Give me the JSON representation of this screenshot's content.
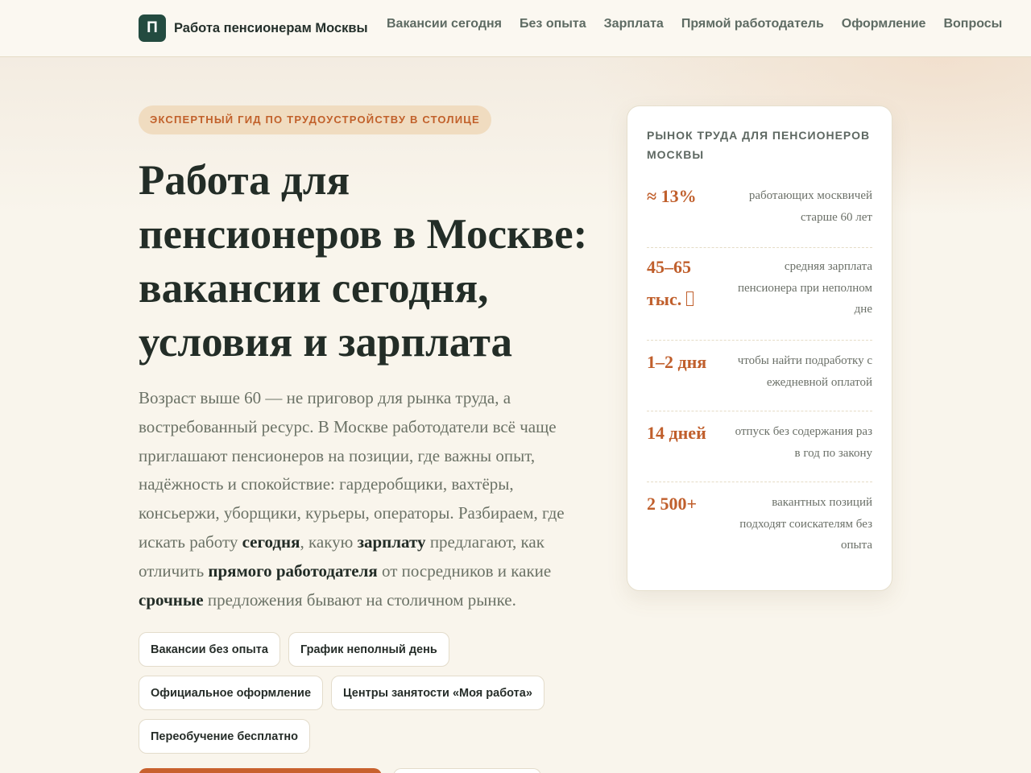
{
  "header": {
    "logo_letter": "П",
    "brand_name": "Работа пенсионерам Москвы",
    "nav": [
      "Вакансии сегодня",
      "Без опыта",
      "Зарплата",
      "Прямой работодатель",
      "Оформление",
      "Вопросы"
    ]
  },
  "hero": {
    "eyebrow": "ЭКСПЕРТНЫЙ ГИД ПО ТРУДОУСТРОЙСТВУ В СТОЛИЦЕ",
    "title": "Работа для пенсионеров в Москве: вакансии сегодня, условия и зарплата",
    "lead": {
      "p1": "Возраст выше 60 — не приговор для рынка труда, а востребованный ресурс. В Москве работодатели всё чаще приглашают пенсионеров на позиции, где важны опыт, надёжность и спокойствие: гардеробщики, вахтёры, консьержи, уборщики, курьеры, операторы. Разбираем, где искать работу ",
      "b1": "сегодня",
      "p2": ", какую ",
      "b2": "зарплату",
      "p3": " предлагают, как отличить ",
      "b3": "прямого работодателя",
      "p4": " от посредников и какие ",
      "b4": "срочные",
      "p5": " предложения бывают на столичном рынке."
    },
    "chips": [
      "Вакансии без опыта",
      "График неполный день",
      "Официальное оформление",
      "Центры занятости «Моя работа»",
      "Переобучение бесплатно"
    ]
  },
  "stats_card": {
    "title": "РЫНОК ТРУДА ДЛЯ ПЕНСИОНЕРОВ МОСКВЫ",
    "items": [
      {
        "value": "≈ 13%",
        "desc": "работающих москвичей старше 60 лет"
      },
      {
        "value": "45–65 тыс.",
        "desc": "средняя зарплата пенсионера при неполном дне"
      },
      {
        "value": "1–2 дня",
        "desc": "чтобы найти подработку с ежедневной оплатой"
      },
      {
        "value": "14 дней",
        "desc": "отпуск без содержания раз в год по закону"
      },
      {
        "value": "2 500+",
        "desc": "вакантных позиций подходят соискателям без опыта"
      }
    ]
  },
  "colors": {
    "accent": "#c05f2c",
    "brand": "#234b40",
    "background": "#f9f5ec"
  }
}
